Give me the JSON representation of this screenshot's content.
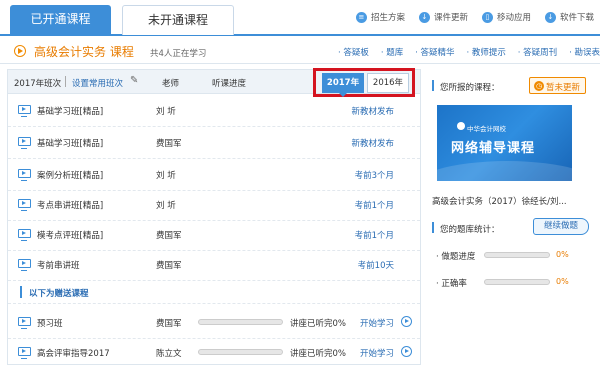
{
  "tabs": {
    "active": "已开通课程",
    "inactive": "未开通课程"
  },
  "top_links": [
    {
      "label": "招生方案",
      "icon": "book-icon"
    },
    {
      "label": "课件更新",
      "icon": "download-icon"
    },
    {
      "label": "移动应用",
      "icon": "phone-icon"
    },
    {
      "label": "软件下载",
      "icon": "download-icon"
    }
  ],
  "course": {
    "title": "高级会计实务  课程",
    "count": "共4人正在学习",
    "links": [
      "· 答疑板",
      "· 题库",
      "· 答疑精华",
      "· 教师提示",
      "· 答疑周刊",
      "· 勘误表"
    ]
  },
  "header": {
    "year_class": "2017年班次",
    "set_common": "设置常用班次",
    "teacher": "老师",
    "progress": "听课进度",
    "year_active": "2017年",
    "year_other": "2016年"
  },
  "rows": [
    {
      "name": "基础学习班[精品]",
      "teacher": "刘  圻",
      "status": "新教材发布"
    },
    {
      "name": "基础学习班[精品]",
      "teacher": "费国军",
      "status": "新教材发布"
    },
    {
      "name": "案例分析班[精品]",
      "teacher": "刘  圻",
      "status": "考前3个月"
    },
    {
      "name": "考点串讲班[精品]",
      "teacher": "刘  圻",
      "status": "考前1个月"
    },
    {
      "name": "模考点评班[精品]",
      "teacher": "费国军",
      "status": "考前1个月"
    },
    {
      "name": "考前串讲班",
      "teacher": "费国军",
      "status": "考前10天"
    }
  ],
  "gift_header": "以下为赠送课程",
  "gift_rows": [
    {
      "name": "预习班",
      "teacher": "费国军",
      "progress_pct": 0,
      "progress_text": "讲座已听完0%",
      "action": "开始学习"
    },
    {
      "name": "高会评审指导2017",
      "teacher": "陈立文",
      "progress_pct": 0,
      "progress_text": "讲座已听完0%",
      "action": "开始学习"
    }
  ],
  "sidebar": {
    "enrolled_title": "您所报的课程：",
    "note_button": "暂未更新",
    "banner_logo": "中华会计网校",
    "banner_title": "网络辅导课程",
    "banner_course": "高级会计实务（2017）徐经长/刘...",
    "bank_title": "您的题库统计：",
    "bank_button": "继续做题",
    "stats": [
      {
        "label": "· 做题进度",
        "pct": 0,
        "pct_text": "0%"
      },
      {
        "label": "· 正确率",
        "pct": 0,
        "pct_text": "0%"
      }
    ]
  }
}
